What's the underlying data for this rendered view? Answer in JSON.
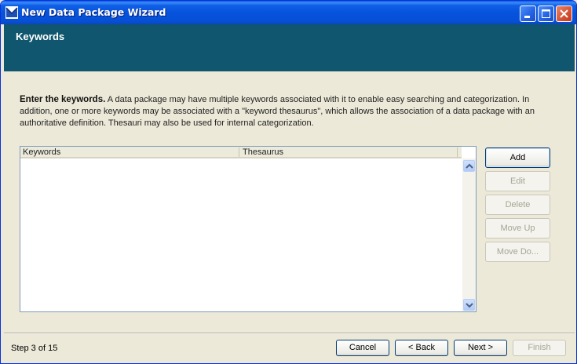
{
  "window": {
    "title": "New Data Package Wizard",
    "controls": {
      "minimize": "minimize-icon",
      "maximize": "maximize-icon",
      "close": "close-icon"
    }
  },
  "header": {
    "title": "Keywords"
  },
  "instructions": {
    "lead": "Enter the keywords.",
    "body": " A data package may have multiple keywords associated with it to enable easy searching and categorization. In addition, one or more keywords may be associated with a \"keyword thesaurus\", which allows the association of a data package with an authoritative definition. Thesauri may also be used for internal categorization."
  },
  "table": {
    "columns": [
      "Keywords",
      "Thesaurus"
    ],
    "rows": []
  },
  "side_buttons": {
    "add": "Add",
    "edit": "Edit",
    "delete": "Delete",
    "move_up": "Move Up",
    "move_down": "Move Do..."
  },
  "footer": {
    "step": "Step 3 of 15",
    "cancel": "Cancel",
    "back": "< Back",
    "next": "Next >",
    "finish": "Finish"
  },
  "colors": {
    "titlebar": "#0753dc",
    "header_band": "#0f566e",
    "background": "#ece9d8",
    "button_border": "#003c74"
  }
}
